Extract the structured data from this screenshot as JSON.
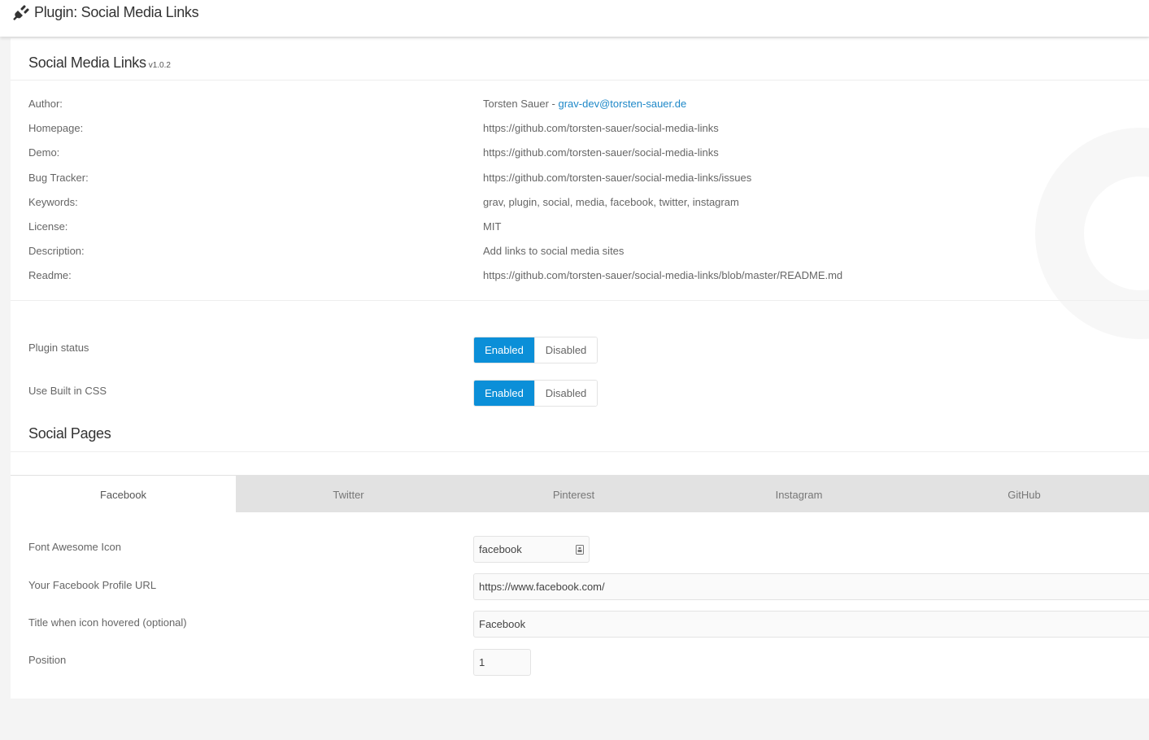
{
  "topbar": {
    "icon": "plug-icon",
    "title": "Plugin: Social Media Links"
  },
  "plugin": {
    "name": "Social Media Links",
    "version": "v1.0.2"
  },
  "info": [
    {
      "label": "Author:",
      "value": "Torsten Sauer - ",
      "link": "grav-dev@torsten-sauer.de"
    },
    {
      "label": "Homepage:",
      "value": "",
      "link": "https://github.com/torsten-sauer/social-media-links"
    },
    {
      "label": "Demo:",
      "value": "",
      "link": "https://github.com/torsten-sauer/social-media-links"
    },
    {
      "label": "Bug Tracker:",
      "value": "",
      "link": "https://github.com/torsten-sauer/social-media-links/issues"
    },
    {
      "label": "Keywords:",
      "value": "grav, plugin, social, media, facebook, twitter, instagram",
      "link": ""
    },
    {
      "label": "License:",
      "value": "MIT",
      "link": ""
    },
    {
      "label": "Description:",
      "value": "Add links to social media sites",
      "link": ""
    },
    {
      "label": "Readme:",
      "value": "",
      "link": "https://github.com/torsten-sauer/social-media-links/blob/master/README.md"
    }
  ],
  "settings": {
    "plugin_status": {
      "label": "Plugin status",
      "on": "Enabled",
      "off": "Disabled",
      "selected": "Enabled"
    },
    "builtin_css": {
      "label": "Use Built in CSS",
      "on": "Enabled",
      "off": "Disabled",
      "selected": "Enabled"
    }
  },
  "social_pages": {
    "title": "Social Pages",
    "tabs": [
      "Facebook",
      "Twitter",
      "Pinterest",
      "Instagram",
      "GitHub"
    ],
    "active_tab": "Facebook",
    "fields": {
      "icon": {
        "label": "Font Awesome Icon",
        "value": "facebook",
        "suffix_icon": "icon-picker-icon"
      },
      "url": {
        "label": "Your Facebook Profile URL",
        "value": "https://www.facebook.com/"
      },
      "title": {
        "label": "Title when icon hovered (optional)",
        "value": "Facebook"
      },
      "position": {
        "label": "Position",
        "value": "1"
      }
    }
  },
  "colors": {
    "accent": "#0b8fd8",
    "link": "#1e88c8",
    "tabbar": "#e2e2e2",
    "background": "#f4f4f4"
  }
}
